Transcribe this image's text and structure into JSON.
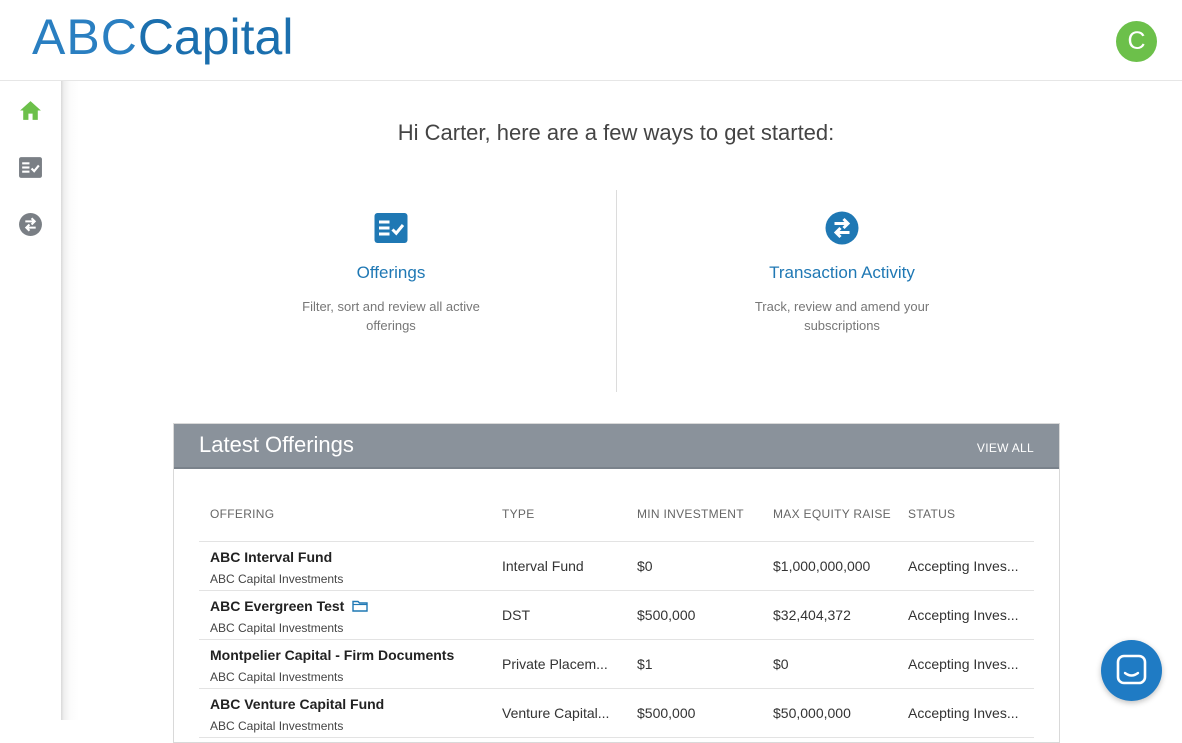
{
  "brand": {
    "part1": "ABC",
    "part2": "Capital"
  },
  "user": {
    "avatar_initial": "C"
  },
  "sidebar": {
    "items": [
      {
        "icon": "home-icon",
        "active": true
      },
      {
        "icon": "checklist-icon",
        "active": false
      },
      {
        "icon": "transfer-icon",
        "active": false
      }
    ]
  },
  "greeting": "Hi Carter, here are a few ways to get started:",
  "cards": [
    {
      "icon": "checklist-icon",
      "title": "Offerings",
      "description": "Filter, sort and review all active offerings"
    },
    {
      "icon": "transfer-icon",
      "title": "Transaction Activity",
      "description": "Track, review and amend your subscriptions"
    }
  ],
  "latest": {
    "title": "Latest Offerings",
    "view_all": "VIEW ALL",
    "columns": [
      "OFFERING",
      "TYPE",
      "MIN INVESTMENT",
      "MAX EQUITY RAISE",
      "STATUS"
    ],
    "rows": [
      {
        "name": "ABC Interval Fund",
        "sponsor": "ABC Capital Investments",
        "type": "Interval Fund",
        "min": "$0",
        "max": "$1,000,000,000",
        "status": "Accepting Inves...",
        "folder": false
      },
      {
        "name": "ABC Evergreen Test",
        "sponsor": "ABC Capital Investments",
        "type": "DST",
        "min": "$500,000",
        "max": "$32,404,372",
        "status": "Accepting Inves...",
        "folder": true
      },
      {
        "name": "Montpelier Capital - Firm Documents",
        "sponsor": "ABC Capital Investments",
        "type": "Private Placem...",
        "min": "$1",
        "max": "$0",
        "status": "Accepting Inves...",
        "folder": false
      },
      {
        "name": "ABC Venture Capital Fund",
        "sponsor": "ABC Capital Investments",
        "type": "Venture Capital...",
        "min": "$500,000",
        "max": "$50,000,000",
        "status": "Accepting Inves...",
        "folder": false
      }
    ]
  },
  "colors": {
    "brand_blue": "#1f78b4",
    "active_green": "#6cc04a",
    "icon_gray": "#7a7f85",
    "panel_header": "#8a929b"
  }
}
